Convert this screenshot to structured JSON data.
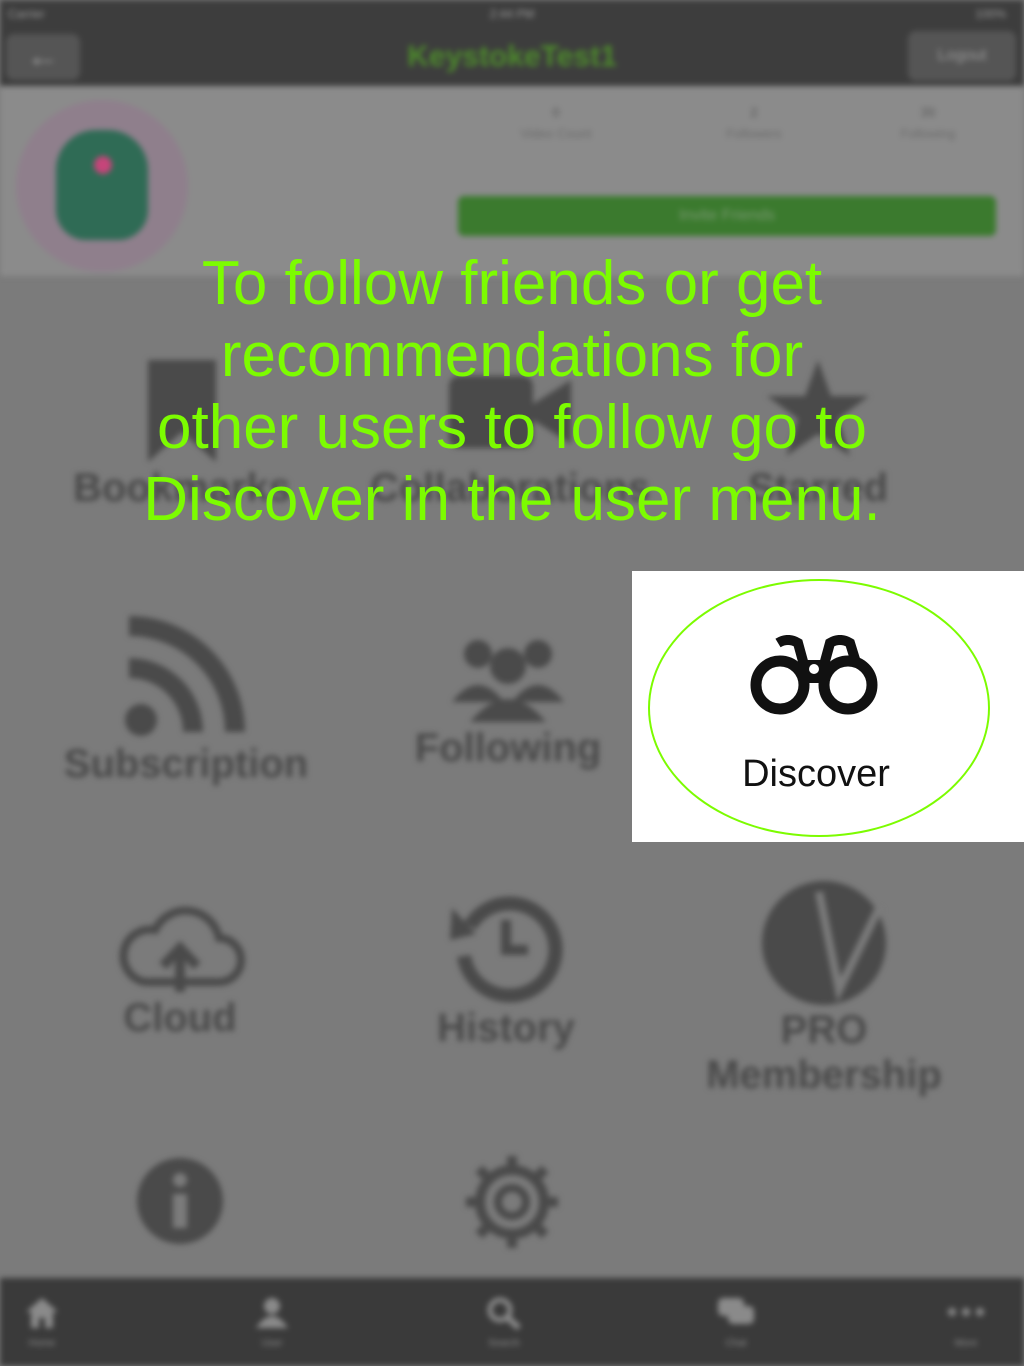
{
  "status_bar": {
    "carrier": "Carrier",
    "time": "2:44 PM",
    "battery": "100%"
  },
  "nav": {
    "back_icon": "back-arrow-icon",
    "title": "KeystokeTest1",
    "logout_label": "Logout"
  },
  "profile": {
    "stats": [
      {
        "value": "0",
        "label": "Video Count"
      },
      {
        "value": "2",
        "label": "Followers"
      },
      {
        "value": "30",
        "label": "Following"
      }
    ],
    "invite_label": "Invite Friends"
  },
  "menu": {
    "bookmarks": "Bookmarks",
    "collaborations": "Collaborations",
    "starred": "Starred",
    "subscription": "Subscription",
    "following": "Following",
    "cloud": "Cloud",
    "history": "History",
    "pro_line1": "PRO",
    "pro_line2": "Membership"
  },
  "tabs": [
    {
      "label": "Home",
      "icon": "home-icon"
    },
    {
      "label": "User",
      "icon": "user-icon"
    },
    {
      "label": "Search",
      "icon": "search-icon"
    },
    {
      "label": "Chat",
      "icon": "chat-icon"
    },
    {
      "label": "More",
      "icon": "more-icon"
    }
  ],
  "overlay": {
    "lines": [
      "To follow friends or get",
      "recommendations for",
      "other users to follow go to",
      "Discover in the user menu."
    ],
    "color": "#7cfc00"
  },
  "discover": {
    "label": "Discover",
    "icon": "binoculars-icon"
  }
}
